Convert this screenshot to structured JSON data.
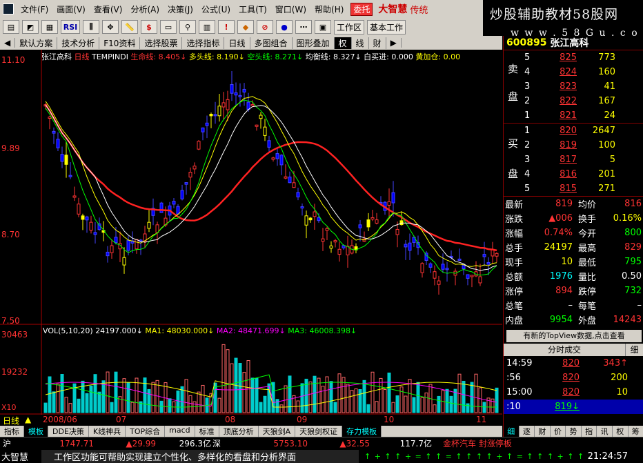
{
  "menu": {
    "items": [
      "文件(F)",
      "画面(V)",
      "查看(V)",
      "分析(A)",
      "决策(J)",
      "公式(U)",
      "工具(T)",
      "窗口(W)",
      "帮助(H)"
    ],
    "weituo": "委托",
    "brand": "大智慧",
    "brand2": "传统"
  },
  "watermark": {
    "line1": "炒股辅助教材58股网",
    "line2": "w w w . 5 8 G u . c o m"
  },
  "toolbar": {
    "rsi": "RSI",
    "workspace": "工作区",
    "basic": "基本工作"
  },
  "tabs": [
    "默认方案",
    "技术分析",
    "F10资料",
    "选择股票",
    "选择指标",
    "日线",
    "多图组合",
    "图形叠加",
    "权",
    "线",
    "财"
  ],
  "chart": {
    "info": {
      "name": "张江高科",
      "period": "日线",
      "formula": "TEMPINDI",
      "l1": "生命线: 8.405↓",
      "l2": "多头线: 8.190↓",
      "l3": "空头线: 8.271↓",
      "l4": "均衡线: 8.327↓",
      "l5": "白买进: 0.000",
      "l6": "黄加仓: 0.00"
    },
    "yaxis": [
      "11.10",
      "9.89",
      "8.70",
      "7.50"
    ],
    "vol": {
      "label": "VOL(5,10,20)",
      "v": "24197.000↓",
      "ma1": "MA1: 48030.000↓",
      "ma2": "MA2: 48471.699↓",
      "ma3": "MA3: 46008.398↓",
      "axis": [
        "30463",
        "19232"
      ],
      "unit": "X10"
    },
    "annotations": {
      "buy": "买",
      "sell": "卖",
      "main": "主力拉升",
      "low": "←7.50"
    },
    "dates": [
      "2008/06",
      "07",
      "08",
      "09",
      "10",
      "11"
    ],
    "period_label": "日线"
  },
  "btabs": [
    "指标",
    "模板",
    "DDE决策",
    "K线神兵",
    "TOP综合",
    "macd",
    "标准",
    "顶底分析",
    "天狼剑A",
    "天狼剑权证",
    "存力模板"
  ],
  "quote": {
    "code": "600895",
    "name": "张江高科",
    "sell": [
      {
        "l": "5",
        "p": "825",
        "v": "773"
      },
      {
        "l": "4",
        "p": "824",
        "v": "160"
      },
      {
        "l": "3",
        "p": "823",
        "v": "41"
      },
      {
        "l": "2",
        "p": "822",
        "v": "167"
      },
      {
        "l": "1",
        "p": "821",
        "v": "24"
      }
    ],
    "buy": [
      {
        "l": "1",
        "p": "820",
        "v": "2647"
      },
      {
        "l": "2",
        "p": "819",
        "v": "100"
      },
      {
        "l": "3",
        "p": "817",
        "v": "5"
      },
      {
        "l": "4",
        "p": "816",
        "v": "201"
      },
      {
        "l": "5",
        "p": "815",
        "v": "271"
      }
    ],
    "sellLbl": [
      "卖",
      "盘"
    ],
    "buyLbl": [
      "买",
      "盘"
    ],
    "stats": [
      {
        "k1": "最新",
        "v1": "819",
        "k2": "均价",
        "v2": "816"
      },
      {
        "k1": "涨跌",
        "v1": "▲006",
        "k2": "换手",
        "v2": "0.16%"
      },
      {
        "k1": "涨幅",
        "v1": "0.74%",
        "k2": "今开",
        "v2": "800"
      },
      {
        "k1": "总手",
        "v1": "24197",
        "k2": "最高",
        "v2": "829"
      },
      {
        "k1": "现手",
        "v1": "10",
        "k2": "最低",
        "v2": "795"
      },
      {
        "k1": "总额",
        "v1": "1976",
        "k2": "量比",
        "v2": "0.50"
      },
      {
        "k1": "涨停",
        "v1": "894",
        "k2": "跌停",
        "v2": "732"
      },
      {
        "k1": "总笔",
        "v1": "–",
        "k2": "每笔",
        "v2": "–"
      },
      {
        "k1": "内盘",
        "v1": "9954",
        "k2": "外盘",
        "v2": "14243"
      }
    ],
    "topview": "有新的TopView数据,点击查看",
    "trhead": [
      "分时成交",
      "细"
    ],
    "trades": [
      {
        "t": "14:59",
        "p": "820",
        "v": "343↑"
      },
      {
        "t": ":56",
        "p": "820",
        "v": "200"
      },
      {
        "t": "15:00",
        "p": "820",
        "v": "10"
      },
      {
        "t": ":10",
        "p": "819↓",
        "v": ""
      }
    ],
    "rpbtabs": [
      "细",
      "逐",
      "财",
      "价",
      "势",
      "指",
      "讯",
      "权",
      "筹"
    ]
  },
  "status": {
    "mkt": "沪",
    "idx": "1747.71",
    "chg": "▲29.99",
    "amt": "296.3亿",
    "sz": "深",
    "szidx": "5753.10",
    "szchg": "▲32.55",
    "szamt": "117.7亿",
    "news": "金杯汽车 封涨停板",
    "app": "大智慧",
    "msg": "工作区功能可帮助实现建立个性化、多样化的看盘和分析界面",
    "time": "21:24:57"
  }
}
